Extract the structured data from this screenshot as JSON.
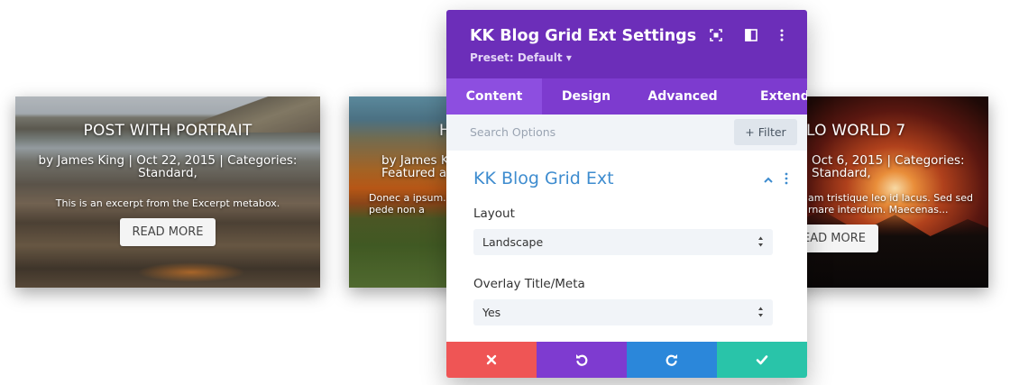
{
  "cards": [
    {
      "title": "POST WITH PORTRAIT",
      "meta": "by James King | Oct 22, 2015 | Categories: Standard,",
      "excerpt": "This is an excerpt from the Excerpt metabox.",
      "read_more": "READ MORE"
    },
    {
      "title_fragment": "H",
      "meta_fragment": "by James K",
      "meta_fragment2": "Featured a",
      "excerpt_fragment": "Donec a ipsum.",
      "excerpt_fragment2": "pede non a"
    },
    {
      "title_fragment": "LO WORLD 7",
      "meta_fragment": "Oct 6, 2015 | Categories:",
      "meta_fragment2": "Standard,",
      "excerpt_fragment": "am tristique leo id lacus. Sed sed",
      "excerpt_fragment2": "rnare interdum. Maecenas...",
      "read_more_fragment": "EAD MORE"
    }
  ],
  "modal": {
    "title": "KK Blog Grid Ext Settings",
    "preset": "Preset: Default ▾",
    "tabs": [
      "Content",
      "Design",
      "Advanced",
      "Extende"
    ],
    "active_tab": "Content",
    "search_placeholder": "Search Options",
    "filter_label": "+ Filter",
    "section_title": "KK Blog Grid Ext",
    "fields": [
      {
        "label": "Layout",
        "value": "Landscape"
      },
      {
        "label": "Overlay Title/Meta",
        "value": "Yes"
      }
    ],
    "colors": {
      "header": "#6c2eb9",
      "tabs": "#7d3bcf",
      "cancel": "#ef5555",
      "undo": "#7e3bd0",
      "redo": "#2b87da",
      "save": "#29c4a9"
    },
    "footer_icons": [
      "close-icon",
      "undo-icon",
      "redo-icon",
      "check-icon"
    ]
  }
}
